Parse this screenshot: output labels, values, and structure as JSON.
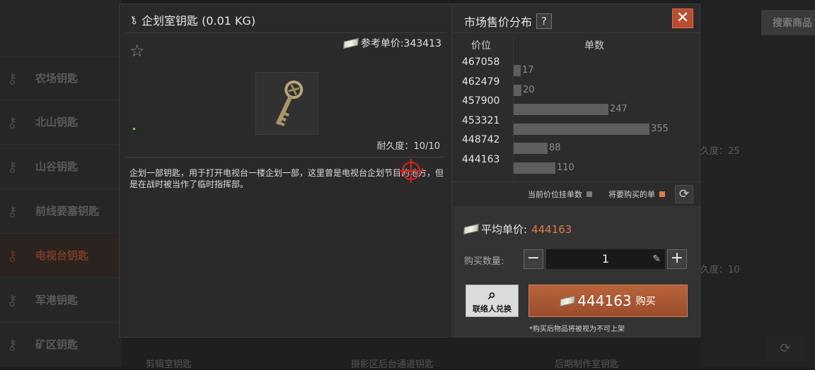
{
  "background": {
    "sidebar_items": [
      "农场钥匙",
      "北山钥匙",
      "山谷钥匙",
      "前线要塞钥匙",
      "电视台钥匙",
      "军港钥匙",
      "矿区钥匙"
    ],
    "active_index": 4,
    "search_label": "搜索商品",
    "durability_1": "久度：25",
    "durability_2": "久度：10",
    "bottom_labels": [
      "剪辑室钥匙",
      "摄影区后台通道钥匙",
      "后期制作室钥匙"
    ]
  },
  "item": {
    "title": "企划室钥匙 (0.01 KG)",
    "ref_price": "参考单价:343413",
    "durability": "耐久度：10/10",
    "description": "企划一部钥匙，用于打开电视台一楼企划一部，这里曾是电视台企划节目的地方，但是在战时被当作了临时指挥部。"
  },
  "market": {
    "title": "市场售价分布",
    "help": "?",
    "close": "✕",
    "col_price": "价位",
    "col_count": "单数",
    "legend_current": "当前价位挂单数",
    "legend_buy": "将要购买的单",
    "colors": {
      "current": "#7a7a7a",
      "buy": "#e07a48"
    }
  },
  "chart_data": {
    "type": "bar",
    "orientation": "horizontal",
    "categories": [
      "467058",
      "462479",
      "457900",
      "453321",
      "448742",
      "444163"
    ],
    "values": [
      17,
      20,
      247,
      355,
      88,
      110
    ]
  },
  "purchase": {
    "avg_label": "平均单价:",
    "avg_value": "444163",
    "qty_label": "购买数量:",
    "qty_value": "1",
    "contact_label": "联络人兑换",
    "buy_amount": "444163",
    "buy_label": "购买",
    "note": "*购买后物品将被视为不可上架"
  }
}
